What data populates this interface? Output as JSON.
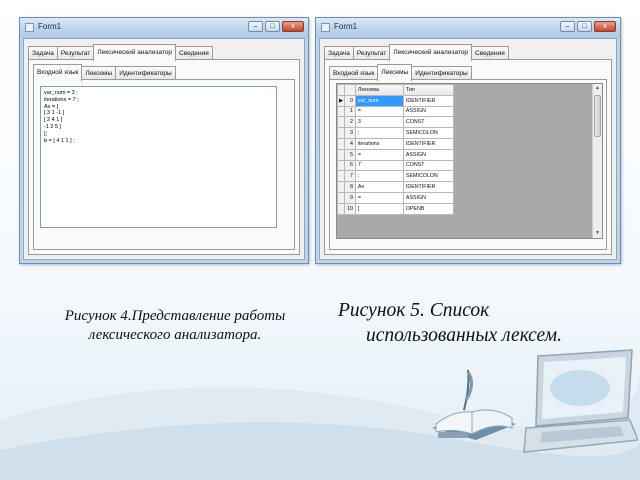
{
  "left_window": {
    "title": "Form1",
    "controls": {
      "minimize": "–",
      "maximize": "□",
      "close": "x"
    },
    "tabs": [
      "Задача",
      "Результат",
      "Лексический анализатор",
      "Сведения"
    ],
    "active_tab": "Лексический анализатор",
    "subtabs": [
      "Входной язык",
      "Лексемы",
      "Идентификаторы"
    ],
    "active_subtab": "Входной язык",
    "code_lines": [
      "var_num = 3 ;",
      "iterations = 7 ;",
      "Ax = [",
      "[ 3 1 -1 ]",
      "[ 2 4 1 ]",
      "-1 2 5 ]",
      "];",
      "b = [ 4 1 1 ] ;"
    ]
  },
  "right_window": {
    "title": "Form1",
    "controls": {
      "minimize": "–",
      "maximize": "□",
      "close": "x"
    },
    "tabs": [
      "Задача",
      "Результат",
      "Лексический анализатор",
      "Сведения"
    ],
    "active_tab": "Лексический анализатор",
    "subtabs": [
      "Входной язык",
      "Лексемы",
      "Идентификаторы"
    ],
    "active_subtab": "Лексемы",
    "grid": {
      "columns": [
        "Лексема",
        "Тип"
      ],
      "current_row_marker": "▶",
      "rows": [
        {
          "index": "0",
          "lexeme": "var_num",
          "type": "IDENTIFIER"
        },
        {
          "index": "1",
          "lexeme": "=",
          "type": "ASSIGN"
        },
        {
          "index": "2",
          "lexeme": "3",
          "type": "CONST"
        },
        {
          "index": "3",
          "lexeme": ";",
          "type": "SEMICOLON"
        },
        {
          "index": "4",
          "lexeme": "iterations",
          "type": "IDENTIFIER"
        },
        {
          "index": "5",
          "lexeme": "=",
          "type": "ASSIGN"
        },
        {
          "index": "6",
          "lexeme": "7",
          "type": "CONST"
        },
        {
          "index": "7",
          "lexeme": ";",
          "type": "SEMICOLON"
        },
        {
          "index": "8",
          "lexeme": "Ax",
          "type": "IDENTIFIER"
        },
        {
          "index": "9",
          "lexeme": "=",
          "type": "ASSIGN"
        },
        {
          "index": "10",
          "lexeme": "[",
          "type": "OPENB"
        }
      ]
    }
  },
  "captions": {
    "figure4": "Рисунок 4.Представление работы лексического анализатора.",
    "figure5_line1": "Рисунок 5. Список",
    "figure5_line2": "использованных лексем."
  },
  "colors": {
    "selection": "#3399ff",
    "window_frame": "#bcd3ea",
    "grid_background": "#a9a9a9"
  }
}
